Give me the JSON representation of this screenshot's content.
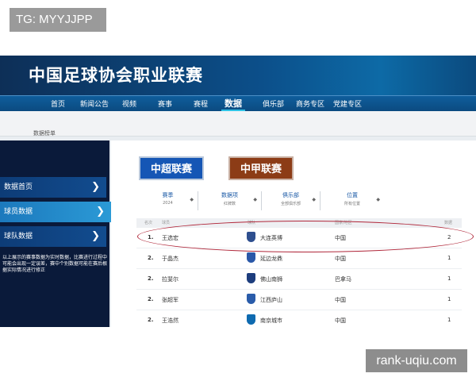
{
  "overlay": {
    "tg": "TG: MYYJJPP",
    "site": "rank-uqiu.com"
  },
  "site": {
    "title": "中国足球协会职业联赛"
  },
  "nav": {
    "items": [
      {
        "label": "首页"
      },
      {
        "label": "新闻公告"
      },
      {
        "label": "视频"
      },
      {
        "label": "赛事"
      },
      {
        "label": "赛程"
      },
      {
        "label": "数据"
      },
      {
        "label": "俱乐部"
      },
      {
        "label": "商务专区"
      },
      {
        "label": "党建专区"
      }
    ],
    "active": "数据"
  },
  "breadcrumb": "数据榜单",
  "sidebar": {
    "items": [
      {
        "label": "数据首页",
        "arrow": "❯"
      },
      {
        "label": "球员数据",
        "arrow": "❯"
      },
      {
        "label": "球队数据",
        "arrow": "❯"
      }
    ],
    "active": "球员数据",
    "note": "以上展示的赛事数据为实时数据，比赛进行过程中可能会出现一定误差，赛中个别数据可能在赛后根据实际情况进行修正"
  },
  "league_tabs": {
    "csl": "中超联赛",
    "cl1": "中甲联赛"
  },
  "filters": [
    {
      "label": "赛季",
      "value": "2024",
      "caret": "◆"
    },
    {
      "label": "数据项",
      "value": "红牌数",
      "caret": "◆"
    },
    {
      "label": "俱乐部",
      "value": "全部俱乐部",
      "caret": "◆"
    },
    {
      "label": "位置",
      "value": "所有位置",
      "caret": "◆"
    }
  ],
  "table": {
    "headers": {
      "rank": "名次",
      "player": "球员",
      "club": "球队",
      "country": "国家/地区",
      "count": "数据"
    },
    "rows": [
      {
        "rank": "1.",
        "player": "王选宏",
        "club": "大连英博",
        "country": "中国",
        "count": "2",
        "crest_color": "#2e4f8f"
      },
      {
        "rank": "2.",
        "player": "于晶杰",
        "club": "延边龙鼎",
        "country": "中国",
        "count": "1",
        "crest_color": "#2a58a8"
      },
      {
        "rank": "2.",
        "player": "拉斐尔",
        "club": "佛山南狮",
        "country": "巴拿马",
        "count": "1",
        "crest_color": "#1d3d7d"
      },
      {
        "rank": "2.",
        "player": "张超军",
        "club": "江西庐山",
        "country": "中国",
        "count": "1",
        "crest_color": "#2a5caa"
      },
      {
        "rank": "2.",
        "player": "王浩然",
        "club": "南京城市",
        "country": "中国",
        "count": "1",
        "crest_color": "#0e6ab0"
      }
    ]
  },
  "colors": {
    "banner": "#0c4f8a",
    "nav_active_underline": "#2fc3e6",
    "csl_button": "#1556b5",
    "cl1_button": "#8c3c16",
    "highlight_ellipse": "#b0273a"
  }
}
